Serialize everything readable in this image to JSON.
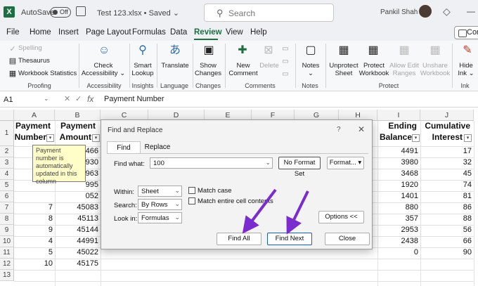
{
  "titlebar": {
    "app_logo": "X",
    "autosave_label": "AutoSave",
    "toggle_state": "Off",
    "doc_name": "Test 123.xlsx",
    "saved": "• Saved",
    "chevron": "⌄",
    "search_placeholder": "Search",
    "user": "Pankil Shah",
    "minimize": "—"
  },
  "menu": {
    "items": [
      "File",
      "Home",
      "Insert",
      "Page Layout",
      "Formulas",
      "Data",
      "Review",
      "View",
      "Help"
    ],
    "active": "Review",
    "comments": "Con"
  },
  "ribbon": {
    "proofing": {
      "spelling": "Spelling",
      "thesaurus": "Thesaurus",
      "workbook_stats": "Workbook Statistics",
      "group": "Proofing"
    },
    "accessibility": {
      "check": "Check",
      "accessibility": "Accessibility",
      "group": "Accessibility"
    },
    "insights": {
      "smart": "Smart",
      "lookup": "Lookup",
      "group": "Insights"
    },
    "language": {
      "translate": "Translate",
      "group": "Language"
    },
    "changes": {
      "show": "Show",
      "changes": "Changes",
      "group": "Changes"
    },
    "comments": {
      "new": "New",
      "comment": "Comment",
      "delete": "Delete",
      "group": "Comments"
    },
    "notes": {
      "notes": "Notes",
      "group": "Notes"
    },
    "protect": {
      "unprotect": "Unprotect",
      "sheet": "Sheet",
      "protect": "Protect",
      "workbook": "Workbook",
      "allow_edit": "Allow Edit",
      "ranges": "Ranges",
      "unshare": "Unshare",
      "unshare_wb": "Workbook",
      "group": "Protect"
    },
    "ink": {
      "hide": "Hide",
      "ink": "Ink",
      "group": "Ink"
    }
  },
  "formula_bar": {
    "name_box": "A1",
    "fx": "fx",
    "value": "Payment Number",
    "cancel": "✕",
    "enter": "✓"
  },
  "grid": {
    "columns": [
      "A",
      "B",
      "C",
      "D",
      "E",
      "F",
      "G",
      "H",
      "I",
      "J"
    ],
    "rows": [
      "1",
      "2",
      "3",
      "4",
      "5",
      "6",
      "7",
      "8",
      "9",
      "10",
      "11",
      "12",
      "13"
    ],
    "headers": {
      "a1": "Payment",
      "a1b": "Number",
      "b1": "Payment",
      "b1b": "Amount",
      "i1": "Ending",
      "i1b": "Balance",
      "j1": "Cumulative",
      "j1b": "Interest"
    },
    "col_a": [
      "",
      "",
      "",
      "",
      "",
      "7",
      "8",
      "9",
      "4",
      "5",
      "10"
    ],
    "col_b": [
      "466",
      "930",
      "963",
      "995",
      "052",
      "45083",
      "45113",
      "45144",
      "44991",
      "45022",
      "45175"
    ],
    "col_i": [
      "4491",
      "3980",
      "3468",
      "1920",
      "1401",
      "880",
      "357",
      "2953",
      "2438",
      "0"
    ],
    "col_j": [
      "17",
      "32",
      "45",
      "74",
      "81",
      "86",
      "88",
      "56",
      "66",
      "90"
    ]
  },
  "note": {
    "text": "Payment number is automatically updated in this column"
  },
  "dialog": {
    "title": "Find and Replace",
    "help": "?",
    "close": "✕",
    "tab_find": "Find",
    "tab_replace": "Replace",
    "find_what_label": "Find what:",
    "find_what_value": "100",
    "no_format": "No Format Set",
    "format_btn": "Format...",
    "within_label": "Within:",
    "within_value": "Sheet",
    "search_label": "Search:",
    "search_value": "By Rows",
    "lookin_label": "Look in:",
    "lookin_value": "Formulas",
    "match_case": "Match case",
    "match_entire": "Match entire cell contents",
    "options_btn": "Options <<",
    "find_all": "Find All",
    "find_next": "Find Next",
    "close_btn": "Close"
  },
  "colors": {
    "excel_green": "#1d6f42",
    "arrow_purple": "#7b2ccf"
  }
}
